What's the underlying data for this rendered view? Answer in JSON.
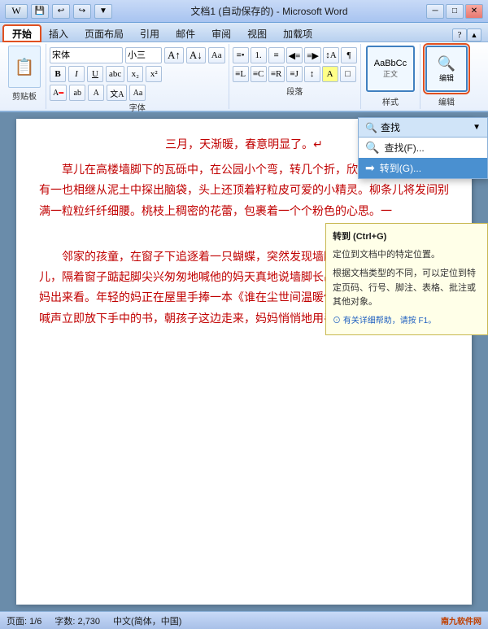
{
  "titleBar": {
    "title": "文档1 (自动保存的) - Microsoft Word",
    "minBtn": "─",
    "maxBtn": "□",
    "closeBtn": "✕"
  },
  "ribbonTabs": {
    "tabs": [
      {
        "label": "开始",
        "active": true
      },
      {
        "label": "插入",
        "active": false
      },
      {
        "label": "页面布局",
        "active": false
      },
      {
        "label": "引用",
        "active": false
      },
      {
        "label": "邮件",
        "active": false
      },
      {
        "label": "审阅",
        "active": false
      },
      {
        "label": "视图",
        "active": false
      },
      {
        "label": "加载项",
        "active": false
      }
    ]
  },
  "ribbon": {
    "pasteLabel": "粘贴",
    "clipboardLabel": "剪贴板",
    "fontName": "宋体",
    "fontSize": "小三",
    "fontLabel": "字体",
    "paraLabel": "段落",
    "styleLabel": "样式",
    "editLabel": "编辑"
  },
  "dropdown": {
    "items": [
      {
        "label": "查找(F)...",
        "icon": "🔍",
        "shortcut": ""
      },
      {
        "label": "转到(G)...",
        "icon": "➡",
        "shortcut": ""
      }
    ]
  },
  "tooltip": {
    "title": "转到 (Ctrl+G)",
    "line1": "定位到文档中的特定位置。",
    "line2": "根据文档类型的不同，可以定位到特定页码、行号、脚注、表格、批注或其他对象。",
    "helpText": "⊙ 有关详细帮助，请按 F1。"
  },
  "document": {
    "para1": "三月，天渐暖，春意明显了。↵",
    "para2": "草儿在高楼墙脚下的瓦砾中，在公园小个弯，转几个折，欣幸地钻了出来。还有一也相继从泥土中探出脑袋，头上还顶着籽粒皮可爱的小精灵。柳条儿将发间别满一粒粒纤纤细腰。桃枝上稠密的花蕾，包裹着一个个粉色的心思。一",
    "para3": "邻家的孩童，在窗子下追逐着一只蝴蝶，突然发现墙脚边些刚钻出泥土的草芽儿，隔着窗子踮起脚尖兴匆匆地喊他的妈天真地说墙脚长出豆芽儿了，非让他的妈妈出来看。年轻的妈正在屋里手捧一本《谁在尘世间温暖你》的小说，听见孩子的喊声立即放下手中的书，朝孩子这边走来，妈妈悄悄地用手指了"
  },
  "statusBar": {
    "page": "页面: 1/6",
    "words": "字数: 2,730",
    "lang": "中文(简体，中国)"
  },
  "watermark": {
    "text": "南九软件网"
  }
}
